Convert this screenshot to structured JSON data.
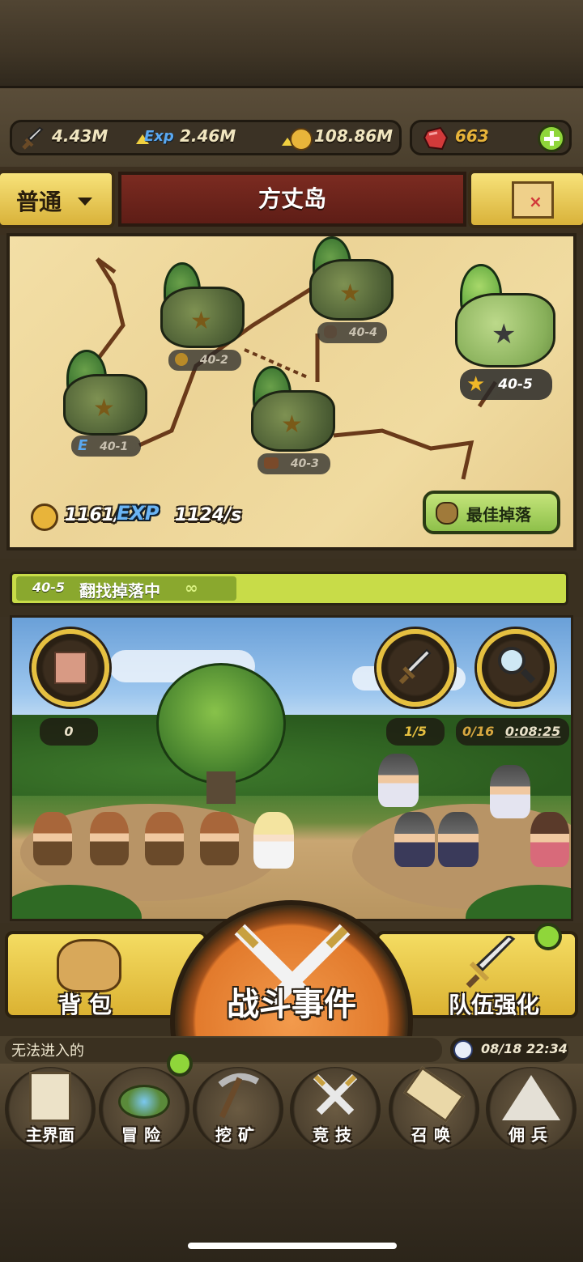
{
  "resources": {
    "attack": "4.43M",
    "exp": "2.46M",
    "exp_badge": "Exp",
    "gold": "108.86M",
    "gems": "663"
  },
  "header": {
    "mode_label": "普通",
    "map_title": "方丈岛"
  },
  "map": {
    "nodes": [
      {
        "label": "40-1",
        "badge": "E"
      },
      {
        "label": "40-2",
        "badge": ""
      },
      {
        "label": "40-3",
        "badge": ""
      },
      {
        "label": "40-4",
        "badge": ""
      },
      {
        "label": "40-5",
        "badge": ""
      }
    ],
    "rate_gold": "1161/",
    "rate_exp_label": "EXP",
    "rate_exp": "1124/s",
    "best_drop_label": "最佳掉落"
  },
  "status": {
    "stage": "40-5",
    "text": "翻找掉落中",
    "infinity": "∞"
  },
  "battle": {
    "left_counter": "0",
    "wave_counter": "1/5",
    "search_counter": "0/16",
    "search_timer": "0:08:25"
  },
  "actions": {
    "bag_label": "背包",
    "battle_event_label": "战斗事件",
    "team_upgrade_label": "队伍强化"
  },
  "info": {
    "notice": "无法进入的",
    "datetime": "08/18 22:34"
  },
  "nav": {
    "items": [
      {
        "label": "主界面"
      },
      {
        "label": "冒险"
      },
      {
        "label": "挖矿"
      },
      {
        "label": "竞技"
      },
      {
        "label": "召唤"
      },
      {
        "label": "佣兵"
      }
    ]
  },
  "colors": {
    "accent_yellow": "#e6c040",
    "title_red": "#7b2b21",
    "status_green": "#c8dc48",
    "notify_green": "#8fd63a"
  }
}
